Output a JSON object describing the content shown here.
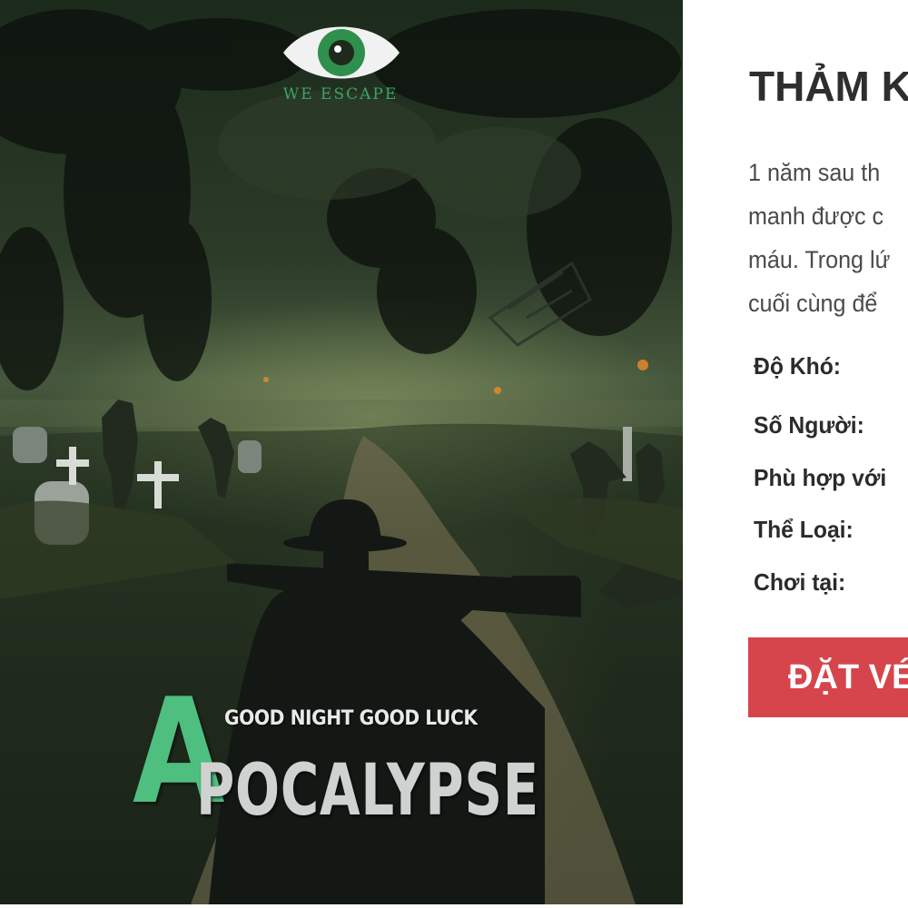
{
  "poster": {
    "logo_text": "WE ESCAPE",
    "tagline": "GOOD NIGHT GOOD LUCK",
    "title_first_letter": "A",
    "title_rest": "POCALYPSE",
    "accent_color": "#4fbf7f"
  },
  "room": {
    "title": "THẢM K",
    "description_lines": [
      "1 năm sau th",
      "manh được c",
      "máu. Trong lứ",
      "cuối cùng để"
    ],
    "info_labels": {
      "difficulty": "Độ Khó:",
      "players": "Số Người:",
      "suitable_for": "Phù hợp với",
      "genre": "Thể Loại:",
      "play_at": "Chơi tại:"
    },
    "book_button": "ĐẶT VÉ",
    "button_color": "#d6454b"
  }
}
